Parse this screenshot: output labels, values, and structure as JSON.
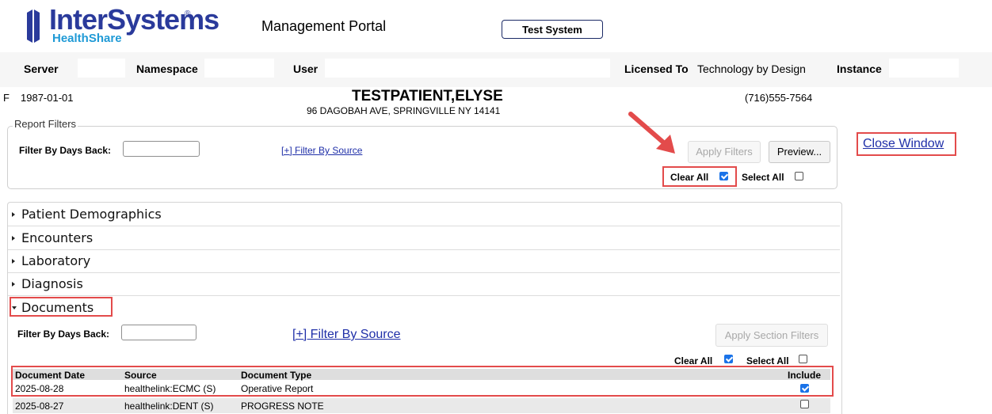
{
  "header": {
    "logo_text": "InterSystems",
    "logo_reg": "®",
    "logo_sub": "HealthShare",
    "title": "Management Portal",
    "test_system_label": "Test System",
    "fields": {
      "server_label": "Server",
      "namespace_label": "Namespace",
      "user_label": "User",
      "licensed_label": "Licensed To",
      "licensed_value": "Technology by Design",
      "instance_label": "Instance"
    }
  },
  "patient": {
    "gender": "F",
    "dob": "1987-01-01",
    "name": "TESTPATIENT,ELYSE",
    "address": "96 DAGOBAH AVE, SPRINGVILLE NY 14141",
    "phone": "(716)555-7564"
  },
  "report_filters": {
    "legend": "Report Filters",
    "days_back_label": "Filter By Days Back:",
    "days_back_value": "",
    "filter_by_source_link": "[+] Filter By Source",
    "apply_filters_label": "Apply Filters",
    "preview_label": "Preview...",
    "clear_all_label": "Clear All",
    "select_all_label": "Select All",
    "clear_all_checked": true,
    "select_all_checked": false
  },
  "close_window_link": "Close Window",
  "sections": [
    {
      "label": "Patient Demographics",
      "expanded": false
    },
    {
      "label": "Encounters",
      "expanded": false
    },
    {
      "label": "Laboratory",
      "expanded": false
    },
    {
      "label": "Diagnosis",
      "expanded": false
    },
    {
      "label": "Documents",
      "expanded": true
    }
  ],
  "documents": {
    "days_back_label": "Filter By Days Back:",
    "days_back_value": "",
    "filter_by_source_link": "[+] Filter By Source",
    "apply_section_filters_label": "Apply Section Filters",
    "clear_all_label": "Clear All",
    "select_all_label": "Select All",
    "clear_all_checked": true,
    "select_all_checked": false,
    "columns": [
      "Document Date",
      "Source",
      "Document Type",
      "Include"
    ],
    "rows": [
      {
        "date": "2025-08-28",
        "source": "healthelink:ECMC (S)",
        "type": "Operative Report",
        "include": true
      },
      {
        "date": "2025-08-27",
        "source": "healthelink:DENT (S)",
        "type": "PROGRESS NOTE",
        "include": false
      }
    ]
  },
  "colors": {
    "brand_blue": "#2a3a9b",
    "brand_light_blue": "#1f9ad6",
    "highlight_red": "#e34b4b",
    "checkbox_blue": "#1a73e8",
    "link_blue": "#1f2fa8"
  }
}
